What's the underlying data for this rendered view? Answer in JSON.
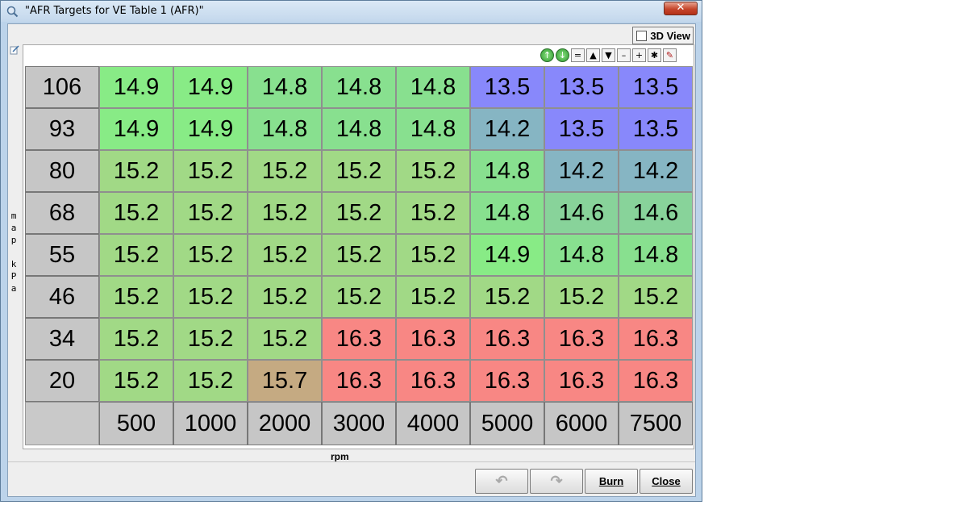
{
  "window": {
    "title": "\"AFR Targets for VE Table 1 (AFR)\"",
    "close_glyph": "✕"
  },
  "options": {
    "view3d_label": "3D View",
    "view3d_checked": false
  },
  "toolbar": [
    "up-circle-icon",
    "down-circle-icon",
    "=",
    "▲",
    "▼",
    "–",
    "+",
    "✱",
    "pen-icon"
  ],
  "axes": {
    "y_label": "map kPa",
    "x_label": "rpm"
  },
  "y_values": [
    "106",
    "93",
    "80",
    "68",
    "55",
    "46",
    "34",
    "20"
  ],
  "x_values": [
    "500",
    "1000",
    "2000",
    "3000",
    "4000",
    "5000",
    "6000",
    "7500"
  ],
  "table": [
    [
      "14.9",
      "14.9",
      "14.8",
      "14.8",
      "14.8",
      "13.5",
      "13.5",
      "13.5"
    ],
    [
      "14.9",
      "14.9",
      "14.8",
      "14.8",
      "14.8",
      "14.2",
      "13.5",
      "13.5"
    ],
    [
      "15.2",
      "15.2",
      "15.2",
      "15.2",
      "15.2",
      "14.8",
      "14.2",
      "14.2"
    ],
    [
      "15.2",
      "15.2",
      "15.2",
      "15.2",
      "15.2",
      "14.8",
      "14.6",
      "14.6"
    ],
    [
      "15.2",
      "15.2",
      "15.2",
      "15.2",
      "15.2",
      "14.9",
      "14.8",
      "14.8"
    ],
    [
      "15.2",
      "15.2",
      "15.2",
      "15.2",
      "15.2",
      "15.2",
      "15.2",
      "15.2"
    ],
    [
      "15.2",
      "15.2",
      "15.2",
      "16.3",
      "16.3",
      "16.3",
      "16.3",
      "16.3"
    ],
    [
      "15.2",
      "15.2",
      "15.7",
      "16.3",
      "16.3",
      "16.3",
      "16.3",
      "16.3"
    ]
  ],
  "colors": {
    "13.5": "#8888fb",
    "14.2": "#86b5c3",
    "14.6": "#88d39a",
    "14.8": "#88e08f",
    "14.9": "#88eb86",
    "15.2": "#a1d986",
    "15.7": "#c5aa82",
    "16.3": "#f88784"
  },
  "buttons": {
    "undo": "↶",
    "redo": "↷",
    "burn": "Burn",
    "close": "Close"
  }
}
